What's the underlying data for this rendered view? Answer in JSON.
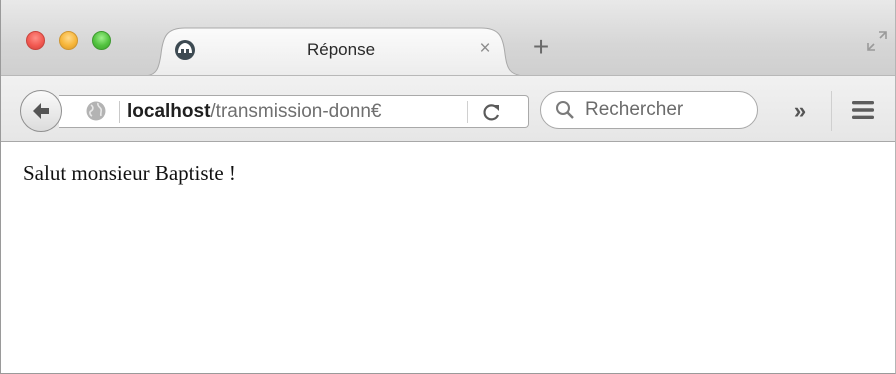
{
  "window": {
    "traffic_lights": [
      "close",
      "minimize",
      "zoom"
    ]
  },
  "tabs": [
    {
      "title": "Réponse",
      "favicon": "firefox-default-favicon-icon",
      "close_glyph": "×"
    }
  ],
  "new_tab_glyph": "+",
  "navigation": {
    "url_host": "localhost",
    "url_path": "/transmission-donn€",
    "search_placeholder": "Rechercher",
    "overflow_glyph": "»"
  },
  "content": {
    "text": "Salut monsieur Baptiste !"
  },
  "colors": {
    "close": "#f25a52",
    "minimize": "#f7b63a",
    "zoom": "#52c23f"
  }
}
